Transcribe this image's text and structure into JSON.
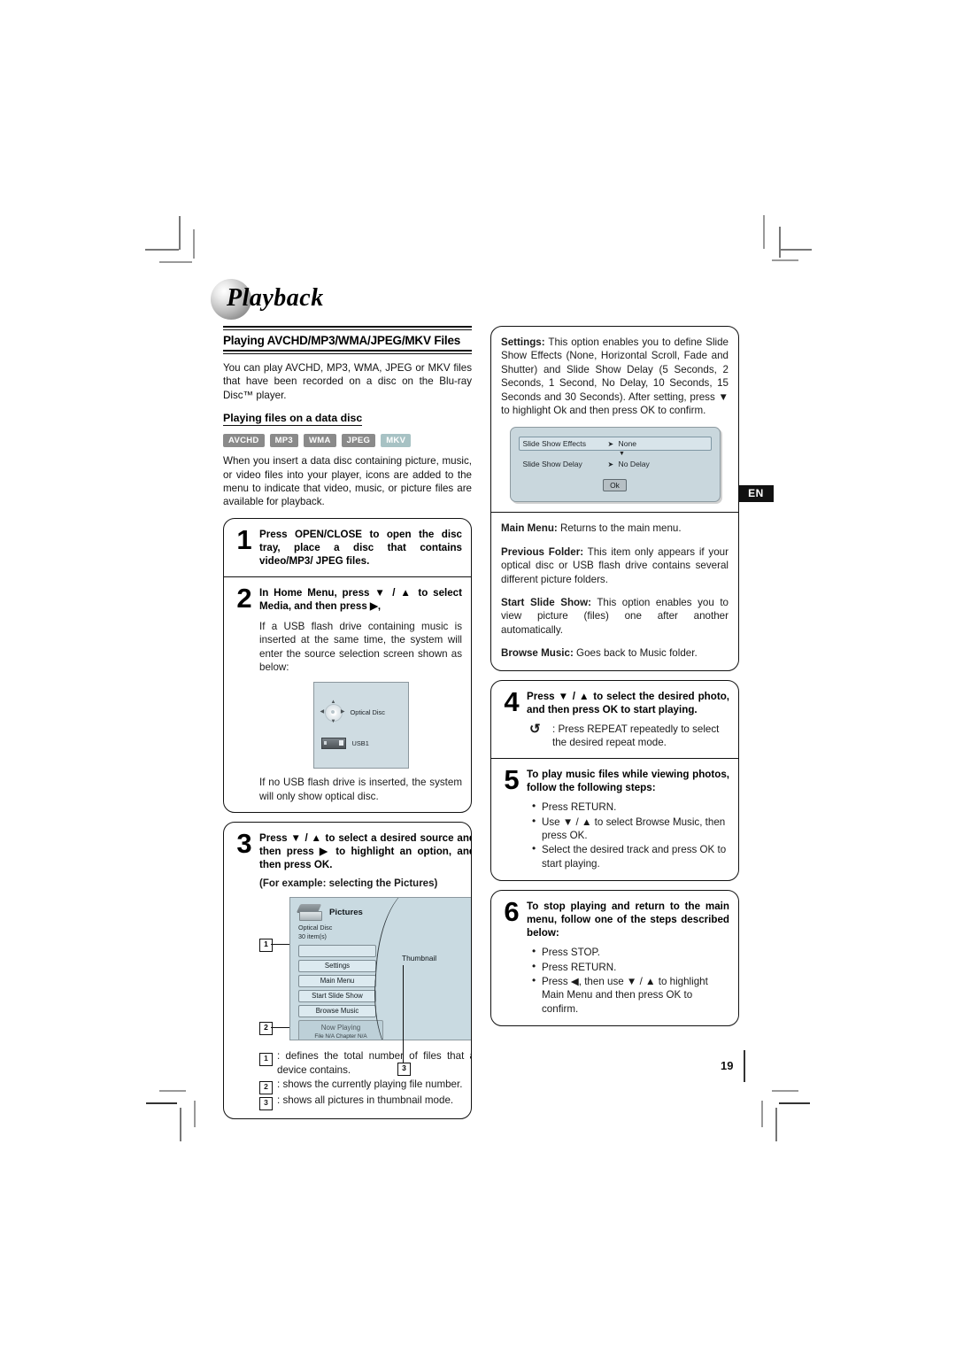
{
  "document": {
    "chapter_title": "Playback",
    "language_tab": "EN",
    "page_number": "19"
  },
  "left_column": {
    "section_title": "Playing AVCHD/MP3/WMA/JPEG/MKV Files",
    "intro": "You can play AVCHD, MP3, WMA, JPEG or MKV files that have been recorded on a disc on the Blu-ray Disc™ player.",
    "sub_title": "Playing files on a data disc",
    "badges": [
      {
        "label": "AVCHD",
        "color": "#8a8a8a"
      },
      {
        "label": "MP3",
        "color": "#8a8a8a"
      },
      {
        "label": "WMA",
        "color": "#8a8a8a"
      },
      {
        "label": "JPEG",
        "color": "#8a8a8a"
      },
      {
        "label": "MKV",
        "color": "#a7c2c4"
      }
    ],
    "para2": "When you insert a data disc containing picture, music, or video files into your player, icons are added to the menu to indicate that video, music, or picture files are available for playback.",
    "steps": [
      {
        "number": "1",
        "lead": "Press OPEN/CLOSE to open the disc tray, place a disc that contains video/MP3/ JPEG files."
      },
      {
        "number": "2",
        "lead": "In Home Menu, press ▼ / ▲ to select Media, and then press ▶,",
        "note": "If a USB flash drive containing music is inserted at the same time, the system will enter the source selection screen shown as below:",
        "note_after": "If no USB flash drive is inserted, the system will only show optical disc."
      },
      {
        "number": "3",
        "lead": "Press ▼ / ▲ to select a desired source and then press ▶ to highlight an option, and then press OK.",
        "sub": "(For example: selecting the Pictures)"
      }
    ],
    "source_screen": {
      "optical_disc_label": "Optical Disc",
      "usb_label": "USB1"
    },
    "pictures_screen": {
      "title": "Pictures",
      "source": "Optical Disc",
      "item_count": "30 item(s)",
      "buttons": [
        "",
        "Settings",
        "Main Menu",
        "Start Slide Show",
        "Browse Music"
      ],
      "now_playing_title": "Now Playing",
      "now_playing_sub": "File N/A   Chapter N/A",
      "thumbnail_label": "Thumbnail",
      "markers": [
        "1",
        "2",
        "3"
      ]
    },
    "footnotes": [
      {
        "num": "1",
        "text": ": defines the total number of files that a device contains."
      },
      {
        "num": "2",
        "text": ": shows the currently playing file number."
      },
      {
        "num": "3",
        "text": ": shows all pictures in thumbnail mode."
      }
    ]
  },
  "right_column": {
    "settings": {
      "label": "Settings:",
      "text": " This option enables you to define Slide Show Effects (None, Horizontal Scroll, Fade and Shutter) and Slide Show Delay (5 Seconds, 2 Seconds, 1 Second, No Delay, 10 Seconds, 15 Seconds and 30 Seconds). After setting, press ▼ to highlight Ok and then press OK to confirm.",
      "dialog": {
        "row1_label": "Slide Show Effects",
        "row1_value": "None",
        "row2_label": "Slide Show Delay",
        "row2_value": "No Delay",
        "ok_label": "Ok"
      }
    },
    "definitions": [
      {
        "label": "Main Menu:",
        "text": " Returns to the main menu."
      },
      {
        "label": "Previous Folder:",
        "text": " This item only appears if your optical disc or USB flash drive contains several different picture folders."
      },
      {
        "label": "Start Slide Show:",
        "text": " This option enables you to view picture (files) one after another automatically."
      },
      {
        "label": "Browse Music:",
        "text": " Goes back to Music folder."
      }
    ],
    "steps": [
      {
        "number": "4",
        "lead": "Press ▼ / ▲ to select the desired photo, and then press OK to start playing.",
        "repeat_icon": "↺",
        "repeat_text": ":   Press REPEAT repeatedly to select the desired repeat mode."
      },
      {
        "number": "5",
        "lead": "To play music files while viewing photos, follow the following steps:",
        "bullets": [
          "Press RETURN.",
          "Use ▼ / ▲ to select Browse Music, then press OK.",
          "Select the desired track and press OK to start playing."
        ]
      },
      {
        "number": "6",
        "lead": "To stop playing and return to the main menu, follow one of the steps described below:",
        "bullets": [
          "Press STOP.",
          "Press RETURN.",
          "Press ◀, then use ▼ / ▲ to highlight Main Menu and then press OK to confirm."
        ]
      }
    ]
  }
}
